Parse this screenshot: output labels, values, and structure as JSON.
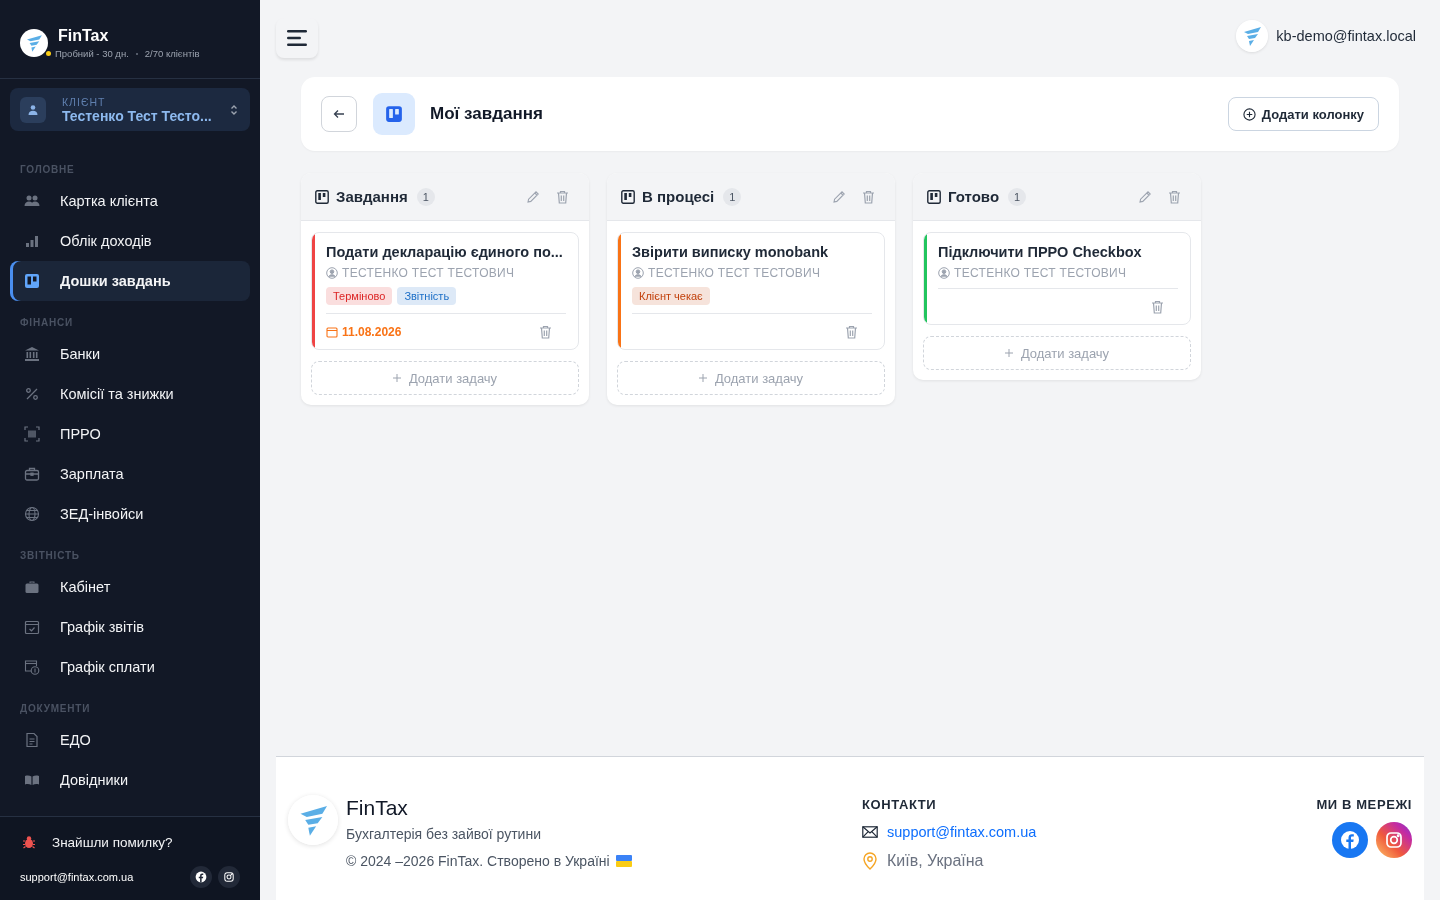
{
  "sidebar": {
    "brand": "FinTax",
    "plan": "Пробний - 30 дн.",
    "clients": "2/70 клієнтів",
    "client_picker": {
      "label": "КЛІЄНТ",
      "value": "Тестенко Тест Тесто..."
    },
    "sections": [
      {
        "title": "ГОЛОВНЕ",
        "items": [
          {
            "label": "Картка клієнта",
            "selected": false
          },
          {
            "label": "Облік доходів",
            "selected": false
          },
          {
            "label": "Дошки завдань",
            "selected": true
          }
        ]
      },
      {
        "title": "ФІНАНСИ",
        "items": [
          {
            "label": "Банки",
            "selected": false
          },
          {
            "label": "Комісії та знижки",
            "selected": false
          },
          {
            "label": "ПРРО",
            "selected": false
          },
          {
            "label": "Зарплата",
            "selected": false
          },
          {
            "label": "ЗЕД-інвойси",
            "selected": false
          }
        ]
      },
      {
        "title": "ЗВІТНІСТЬ",
        "items": [
          {
            "label": "Кабінет",
            "selected": false
          },
          {
            "label": "Графік звітів",
            "selected": false
          },
          {
            "label": "Графік сплати",
            "selected": false
          }
        ]
      },
      {
        "title": "ДОКУМЕНТИ",
        "items": [
          {
            "label": "ЕДО",
            "selected": false
          },
          {
            "label": "Довідники",
            "selected": false
          }
        ]
      }
    ],
    "bug_report": "Знайшли помилку?",
    "support_email": "support@fintax.com.ua"
  },
  "topbar": {
    "user_email": "kb-demo@fintax.local"
  },
  "board": {
    "title": "Мої завдання",
    "add_column": "Додати колонку",
    "columns": [
      {
        "title": "Завдання",
        "count": "1",
        "add_task": "Додати задачу",
        "cards": [
          {
            "title": "Подати декларацію єдиного по...",
            "assignee": "ТЕСТЕНКО ТЕСТ ТЕСТОВИЧ",
            "color": "#ef4444",
            "tags": [
              {
                "label": "Терміново",
                "color": "#dc2626"
              },
              {
                "label": "Звітність",
                "color": "#1d6fc7"
              }
            ],
            "due": "11.08.2026"
          }
        ]
      },
      {
        "title": "В процесі",
        "count": "1",
        "add_task": "Додати задачу",
        "cards": [
          {
            "title": "Звірити виписку monobank",
            "assignee": "ТЕСТЕНКО ТЕСТ ТЕСТОВИЧ",
            "color": "#f97316",
            "tags": [
              {
                "label": "Клієнт чекає",
                "color": "#c2410c"
              }
            ]
          }
        ]
      },
      {
        "title": "Готово",
        "count": "1",
        "add_task": "Додати задачу",
        "cards": [
          {
            "title": "Підключити ПРРО Checkbox",
            "assignee": "ТЕСТЕНКО ТЕСТ ТЕСТОВИЧ",
            "color": "#22c55e"
          }
        ]
      }
    ]
  },
  "footer": {
    "brand": "FinTax",
    "tagline": "Бухгалтерія без зайвої рутини",
    "copyright": "© 2024 –2026 FinTax. Створено в Україні",
    "contacts_title": "КОНТАКТИ",
    "email": "support@fintax.com.ua",
    "location": "Київ, Україна",
    "social_title": "МИ В МЕРЕЖІ"
  }
}
